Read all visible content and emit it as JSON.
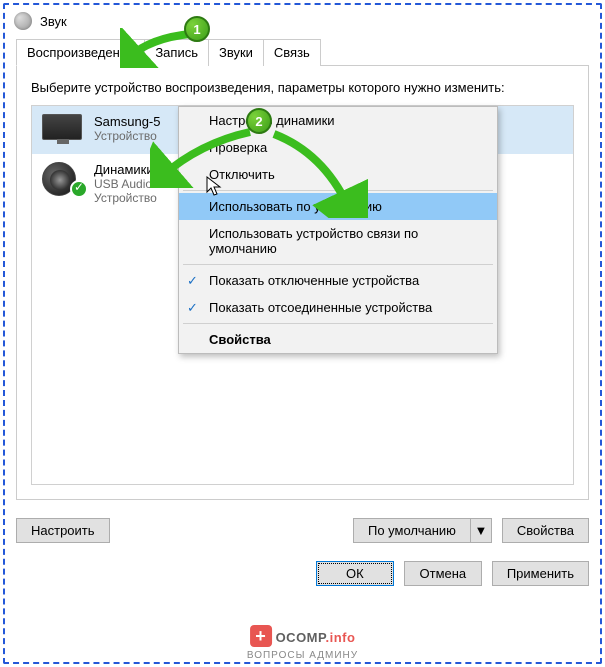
{
  "window": {
    "title": "Звук"
  },
  "tabs": [
    {
      "label": "Воспроизведение",
      "active": true
    },
    {
      "label": "Запись",
      "active": false
    },
    {
      "label": "Звуки",
      "active": false
    },
    {
      "label": "Связь",
      "active": false
    }
  ],
  "instruction": "Выберите устройство воспроизведения, параметры которого нужно изменить:",
  "devices": [
    {
      "name": "Samsung-5",
      "sub": "Устройство",
      "selected": true,
      "icon": "monitor"
    },
    {
      "name": "Динамики",
      "sub1": "USB Audio",
      "sub2": "Устройство",
      "selected": false,
      "icon": "speaker",
      "default": true
    }
  ],
  "context_menu": {
    "items": [
      {
        "label": "Настроить динамики",
        "type": "item"
      },
      {
        "label": "Проверка",
        "type": "item"
      },
      {
        "label": "Отключить",
        "type": "item"
      },
      {
        "type": "sep"
      },
      {
        "label": "Использовать по умолчанию",
        "type": "item",
        "highlight": true
      },
      {
        "label": "Использовать устройство связи по умолчанию",
        "type": "item"
      },
      {
        "type": "sep"
      },
      {
        "label": "Показать отключенные устройства",
        "type": "check"
      },
      {
        "label": "Показать отсоединенные устройства",
        "type": "check"
      },
      {
        "type": "sep"
      },
      {
        "label": "Свойства",
        "type": "item",
        "bold": true
      }
    ]
  },
  "buttons": {
    "configure": "Настроить",
    "default": "По умолчанию",
    "properties": "Свойства",
    "ok": "ОК",
    "cancel": "Отмена",
    "apply": "Применить"
  },
  "badges": {
    "one": "1",
    "two": "2"
  },
  "watermark": {
    "brand": "OCOMP",
    "suffix": ".info",
    "sub": "ВОПРОСЫ АДМИНУ"
  }
}
